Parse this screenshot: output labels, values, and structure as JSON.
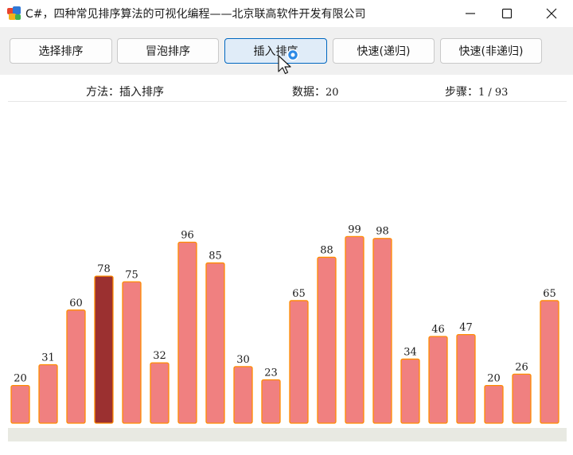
{
  "window": {
    "title": "C#，四种常见排序算法的可视化编程——北京联高软件开发有限公司",
    "icons": [
      "app-icon",
      "minimize-icon",
      "maximize-icon",
      "close-icon"
    ]
  },
  "toolbar": {
    "buttons": [
      {
        "label": "选择排序",
        "active": false
      },
      {
        "label": "冒泡排序",
        "active": false
      },
      {
        "label": "插入排序",
        "active": true
      },
      {
        "label": "快速(递归)",
        "active": false
      },
      {
        "label": "快速(非递归)",
        "active": false
      }
    ]
  },
  "status": {
    "method_label": "方法：",
    "method_value": "插入排序",
    "data_label": "数据：",
    "data_value": "20",
    "steps_label": "步骤：",
    "steps_value": "1 / 93"
  },
  "colors": {
    "bar_fill": "#f08080",
    "bar_stroke": "#ff8c00",
    "highlight_fill": "#9b3030",
    "accent": "#0067c0"
  },
  "chart_data": {
    "type": "bar",
    "values": [
      20,
      31,
      60,
      78,
      75,
      32,
      96,
      85,
      30,
      23,
      65,
      88,
      99,
      98,
      34,
      46,
      47,
      20,
      26,
      65
    ],
    "highlight_index": 3,
    "ylim": [
      0,
      100
    ]
  }
}
